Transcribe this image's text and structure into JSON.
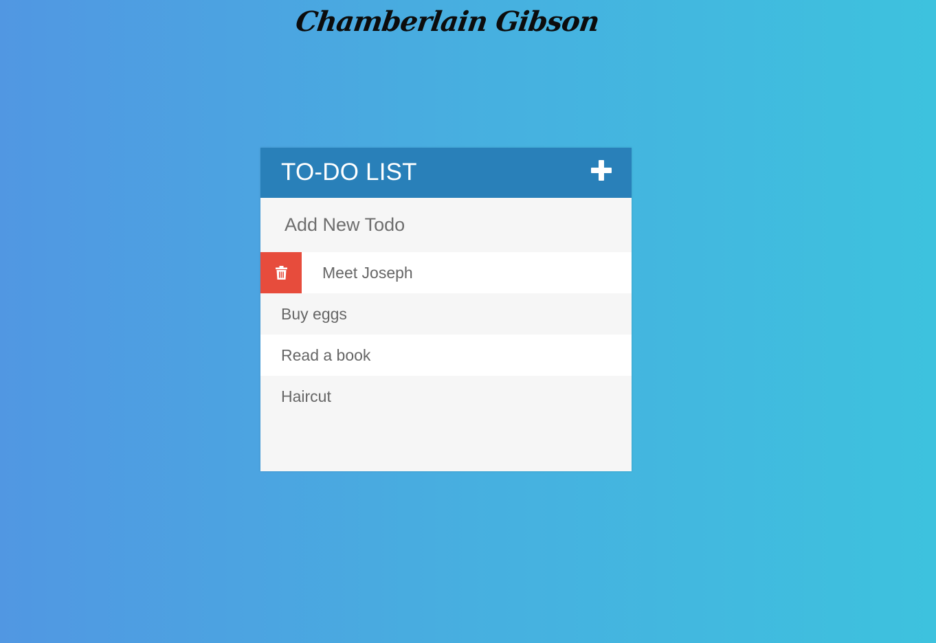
{
  "author": {
    "name": "Chamberlain Gibson"
  },
  "todo_app": {
    "title": "TO-DO LIST",
    "toggle_icon": "plus-icon",
    "input": {
      "placeholder": "Add New Todo",
      "value": ""
    },
    "delete_icon": "trash-icon",
    "items": [
      {
        "text": "Meet Joseph",
        "hovered": true
      },
      {
        "text": "Buy eggs",
        "hovered": false
      },
      {
        "text": "Read a book",
        "hovered": false
      },
      {
        "text": "Haircut",
        "hovered": false
      }
    ]
  },
  "colors": {
    "header": "#2980b9",
    "delete": "#e74c3c",
    "gradient_start": "#5197e2",
    "gradient_end": "#3dc2de"
  }
}
